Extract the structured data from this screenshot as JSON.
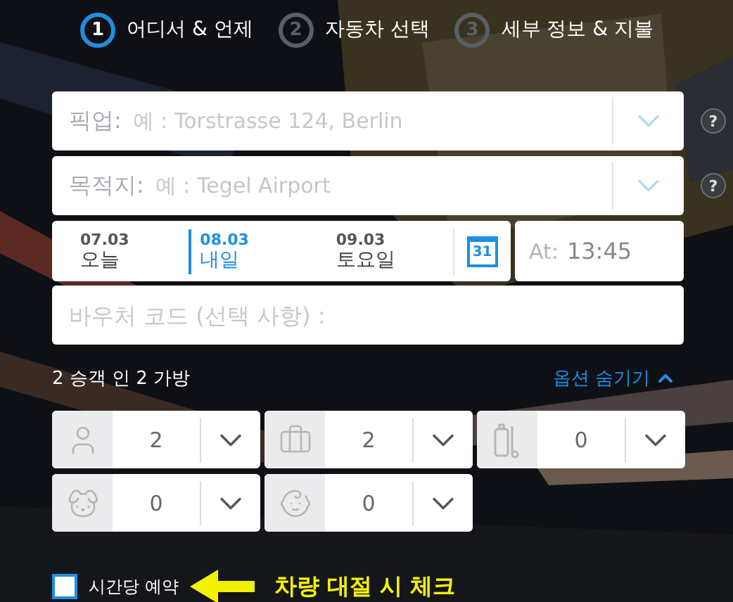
{
  "steps": [
    {
      "number": "1",
      "label": "어디서 & 언제",
      "selected": true
    },
    {
      "number": "2",
      "label": "자동차 선택",
      "selected": false
    },
    {
      "number": "3",
      "label": "세부 정보 & 지불",
      "selected": false
    }
  ],
  "pickup": {
    "label": "픽업:",
    "placeholder": "예 : Torstrasse 124, Berlin",
    "help": "?"
  },
  "destination": {
    "label": "목적지:",
    "placeholder": "예 : Tegel Airport",
    "help": "?"
  },
  "dates": [
    {
      "date": "07.03",
      "day": "오늘",
      "selected": false
    },
    {
      "date": "08.03",
      "day": "내일",
      "selected": true
    },
    {
      "date": "09.03",
      "day": "토요일",
      "selected": false
    }
  ],
  "calendar_day": "31",
  "time": {
    "label": "At:",
    "value": "13:45"
  },
  "voucher": {
    "placeholder": "바우처 코드 (선택 사항) :"
  },
  "summary": "2 승객 인 2 가방",
  "options_toggle": {
    "label": "옵션 숨기기",
    "expanded": true
  },
  "counters": [
    {
      "kind": "person",
      "value": "2"
    },
    {
      "kind": "suitcase",
      "value": "2"
    },
    {
      "kind": "golf",
      "value": "0"
    },
    {
      "kind": "dog",
      "value": "0"
    },
    {
      "kind": "baby",
      "value": "0"
    }
  ],
  "hourly": {
    "label": "시간당 예약",
    "checked": false
  },
  "annotation": {
    "text": "차량 대절 시 체크"
  }
}
